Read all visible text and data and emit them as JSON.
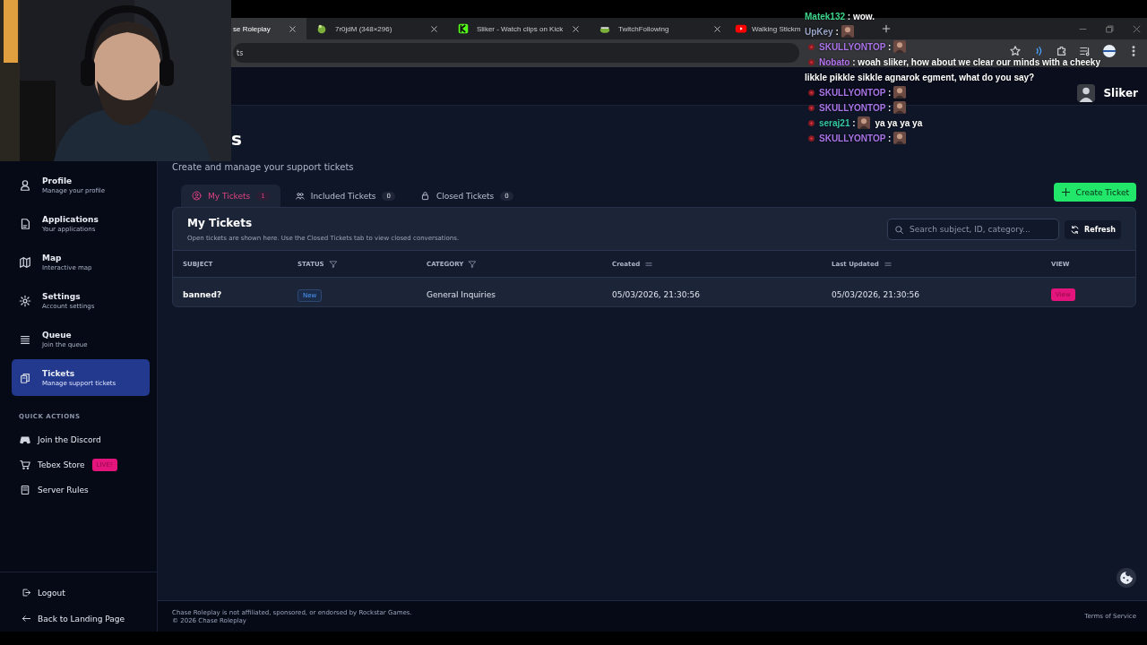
{
  "browser": {
    "tabs": [
      {
        "title": "se Roleplay",
        "selected": true
      },
      {
        "title": "7r0jdM (348×296)",
        "selected": false
      },
      {
        "title": "Sliker - Watch clips on Kick",
        "selected": false
      },
      {
        "title": "TwitchFollowing",
        "selected": false
      },
      {
        "title": "Walking Stickm",
        "selected": false
      }
    ],
    "address": "ts"
  },
  "header": {
    "user": "Sliker"
  },
  "sidebar": {
    "items": [
      {
        "label": "Profile",
        "sublabel": "Manage your profile",
        "selected": false
      },
      {
        "label": "Applications",
        "sublabel": "Your applications",
        "selected": false
      },
      {
        "label": "Map",
        "sublabel": "Interactive map",
        "selected": false
      },
      {
        "label": "Settings",
        "sublabel": "Account settings",
        "selected": false
      },
      {
        "label": "Queue",
        "sublabel": "Join the queue",
        "selected": false
      },
      {
        "label": "Tickets",
        "sublabel": "Manage support tickets",
        "selected": true
      }
    ],
    "quick_title": "QUICK ACTIONS",
    "quick_actions": [
      {
        "label": "Join the Discord"
      },
      {
        "label": "Tebex Store",
        "badge": "LIVE!"
      },
      {
        "label": "Server Rules"
      }
    ],
    "bottom": [
      {
        "label": "Logout"
      },
      {
        "label": "Back to Landing Page"
      }
    ]
  },
  "page": {
    "title": "s",
    "subtitle": "Create and manage your support tickets",
    "create_button": "Create Ticket",
    "tabs": [
      {
        "label": "My Tickets",
        "count": "1",
        "selected": true
      },
      {
        "label": "Included Tickets",
        "count": "0",
        "selected": false
      },
      {
        "label": "Closed Tickets",
        "count": "0",
        "selected": false
      }
    ],
    "panel": {
      "title": "My Tickets",
      "description": "Open tickets are shown here. Use the Closed Tickets tab to view closed conversations.",
      "search": {
        "placeholder": "Search subject, ID, category..."
      },
      "refresh": "Refresh",
      "columns": [
        {
          "label": "SUBJECT",
          "kind": "plain"
        },
        {
          "label": "STATUS",
          "kind": "filter"
        },
        {
          "label": "CATEGORY",
          "kind": "filter"
        },
        {
          "label": "Created",
          "kind": "sort"
        },
        {
          "label": "Last Updated",
          "kind": "sort"
        },
        {
          "label": "VIEW",
          "kind": "plain"
        }
      ],
      "rows": [
        {
          "subject": "banned?",
          "status": "New",
          "category": "General Inquiries",
          "created": "05/03/2026, 21:30:56",
          "updated": "05/03/2026, 21:30:56",
          "action": "View"
        }
      ]
    }
  },
  "footer": {
    "disclaimer": "Chase Roleplay is not affiliated, sponsored, or endorsed by Rockstar Games.",
    "copyright": "© 2026 Chase Roleplay",
    "link": "Terms of Service"
  },
  "chat": {
    "messages": [
      {
        "name": "Matek132",
        "color": "#3dd68c",
        "separator": ":",
        "badge": false,
        "text": "wow.",
        "emote": false
      },
      {
        "name": "UpKey",
        "color": "#9aa4c8",
        "separator": ":",
        "badge": false,
        "emote": true
      },
      {
        "name": "SKULLYONTOP",
        "color": "#a974e8",
        "separator": ":",
        "badge": true,
        "emote": true
      },
      {
        "name": "Nobato",
        "color": "#b574f0",
        "separator": ":",
        "badge": true,
        "text": "woah sliker, how about we clear our minds with a cheeky likkle pikkle sikkle agnarok egment, what do you say?",
        "emote": false
      },
      {
        "name": "SKULLYONTOP",
        "color": "#a974e8",
        "separator": ":",
        "badge": true,
        "emote": true
      },
      {
        "name": "SKULLYONTOP",
        "color": "#a974e8",
        "separator": ":",
        "badge": true,
        "emote": true
      },
      {
        "name": "seraj21",
        "color": "#36c9a4",
        "separator": ":",
        "badge": true,
        "text": "ya ya ya ya",
        "emote": true
      },
      {
        "name": "SKULLYONTOP",
        "color": "#a974e8",
        "separator": ":",
        "badge": true,
        "emote": true
      }
    ]
  }
}
